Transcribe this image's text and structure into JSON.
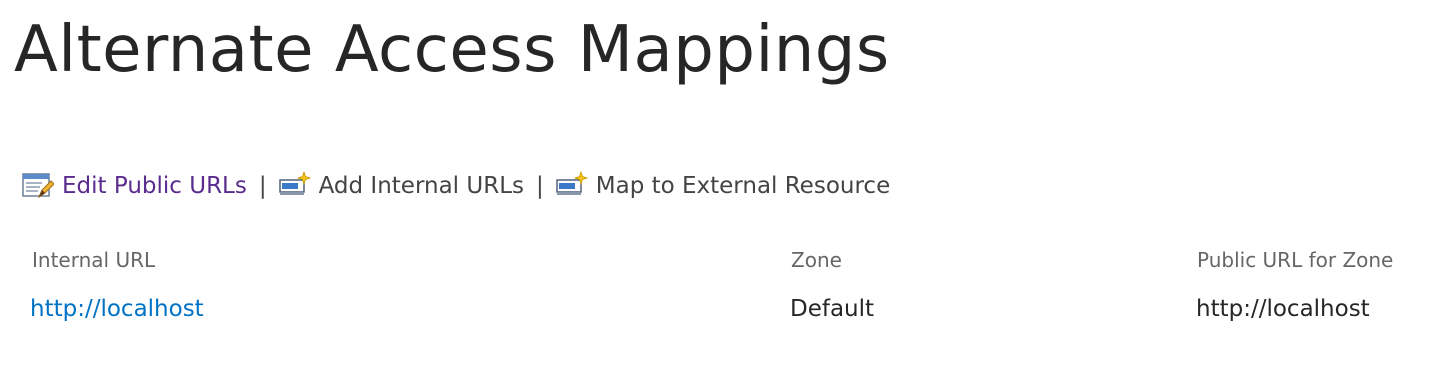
{
  "page": {
    "title": "Alternate Access Mappings"
  },
  "toolbar": {
    "actions": [
      {
        "label": "Edit Public URLs",
        "icon": "edit-list-icon"
      },
      {
        "label": "Add Internal URLs",
        "icon": "add-url-icon"
      },
      {
        "label": "Map to External Resource",
        "icon": "map-external-icon"
      }
    ],
    "separator": "|"
  },
  "grid": {
    "columns": [
      "Internal URL",
      "Zone",
      "Public URL for Zone"
    ],
    "rows": [
      {
        "internal_url": "http://localhost",
        "zone": "Default",
        "public_url": "http://localhost"
      }
    ]
  },
  "colors": {
    "visited_link": "#5b2c8f",
    "link": "#0072c6",
    "text": "#262626",
    "muted_text": "#666666"
  }
}
